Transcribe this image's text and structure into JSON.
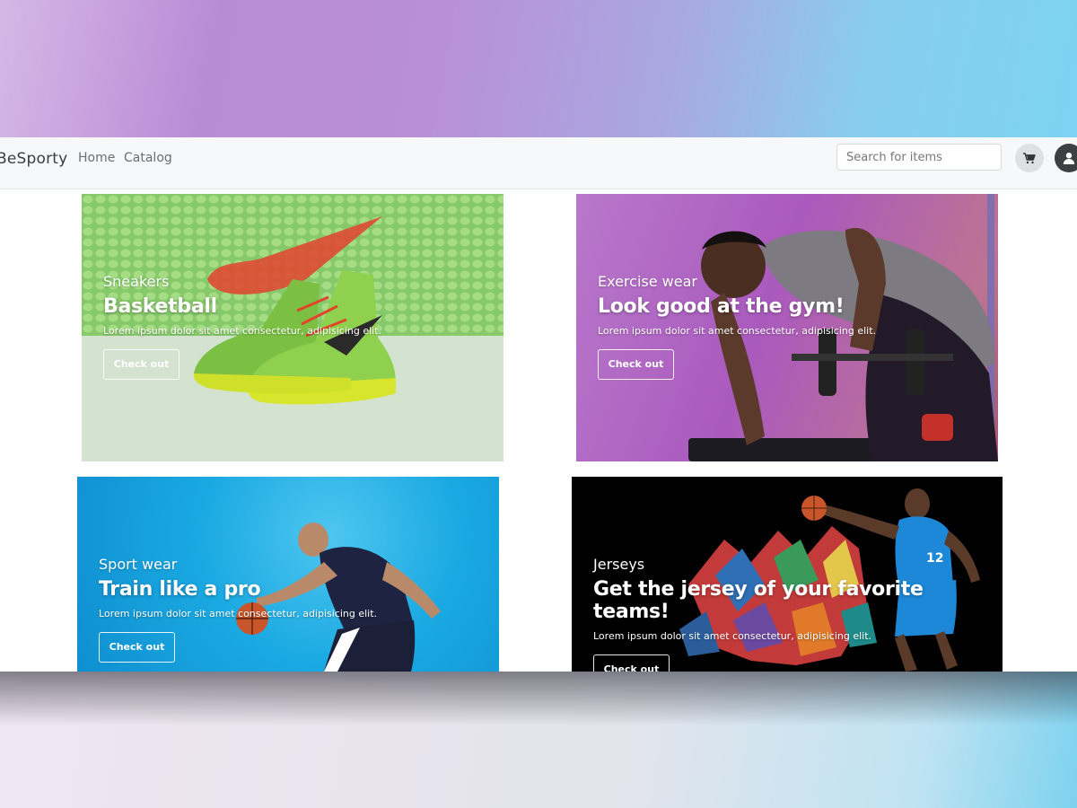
{
  "navbar": {
    "brand": "BeSporty",
    "links": [
      "Home",
      "Catalog"
    ],
    "search_placeholder": "Search for items",
    "cart_icon": "cart-icon",
    "user_icon": "user-icon"
  },
  "cards": [
    {
      "subtitle": "Sneakers",
      "title": "Basketball",
      "description": "Lorem ipsum dolor sit amet consectetur, adipisicing elit.",
      "button": "Check out",
      "image": "basketball-sneakers-image"
    },
    {
      "subtitle": "Exercise wear",
      "title": "Look good at the gym!",
      "description": "Lorem ipsum dolor sit amet consectetur, adipisicing elit.",
      "button": "Check out",
      "image": "gym-athlete-image"
    },
    {
      "subtitle": "Sport wear",
      "title": "Train like a pro",
      "description": "Lorem ipsum dolor sit amet consectetur, adipisicing elit.",
      "button": "Check out",
      "image": "basketball-player-image"
    },
    {
      "subtitle": "Jerseys",
      "title": "Get the jersey of your favorite teams!",
      "description": "Lorem ipsum dolor sit amet consectetur, adipisicing elit.",
      "button": "Check out",
      "image": "jerseys-player-image"
    }
  ],
  "colors": {
    "navbar_bg": "#f7f8f9",
    "card1_bg": "#8fcf72",
    "card2_bg": "#b66ac9",
    "card3_bg": "#1aa9e2",
    "card4_bg": "#000000"
  }
}
